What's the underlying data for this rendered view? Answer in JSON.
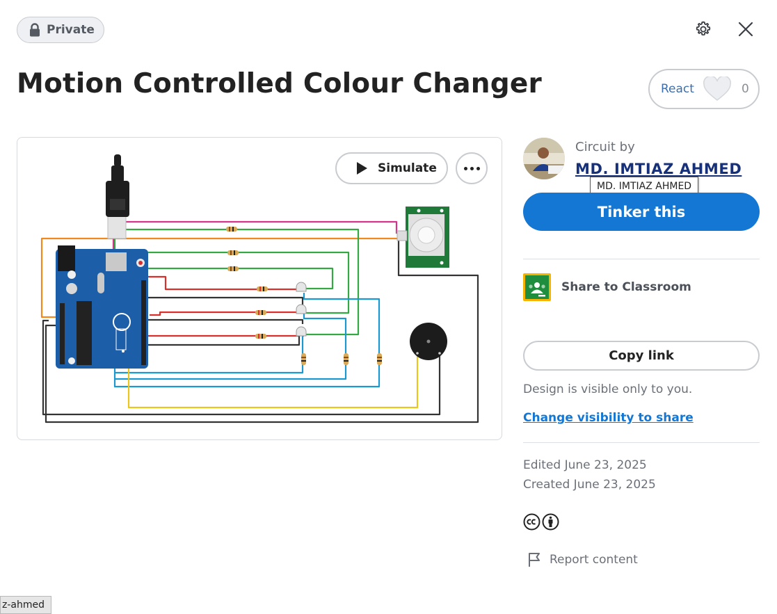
{
  "header": {
    "privacy_badge": "Private",
    "settings_icon": "gear-icon",
    "close_icon": "close-icon"
  },
  "project": {
    "title": "Motion Controlled Colour Changer",
    "react_label": "React",
    "react_count": "0"
  },
  "viewer": {
    "simulate_label": "Simulate",
    "more_icon": "more-horizontal-icon"
  },
  "author": {
    "caption": "Circuit by",
    "name": "MD. IMTIAZ AHMED",
    "tooltip": "MD. IMTIAZ AHMED"
  },
  "actions": {
    "tinker_label": "Tinker this",
    "classroom_label": "Share to Classroom",
    "copy_link_label": "Copy link",
    "visibility_note": "Design is visible only to you.",
    "visibility_link": "Change visibility to share"
  },
  "meta": {
    "edited": "Edited June 23, 2025",
    "created": "Created June 23, 2025",
    "license_icons": [
      "cc-icon",
      "attribution-icon"
    ],
    "report_label": "Report content"
  },
  "status_bar": {
    "url_fragment": "z-ahmed"
  },
  "colors": {
    "primary_blue": "#1477d4",
    "author_link": "#17307a",
    "classroom_green": "#1e8e3e",
    "classroom_yellow": "#f5b400",
    "arduino_blue": "#1d5ea8"
  }
}
